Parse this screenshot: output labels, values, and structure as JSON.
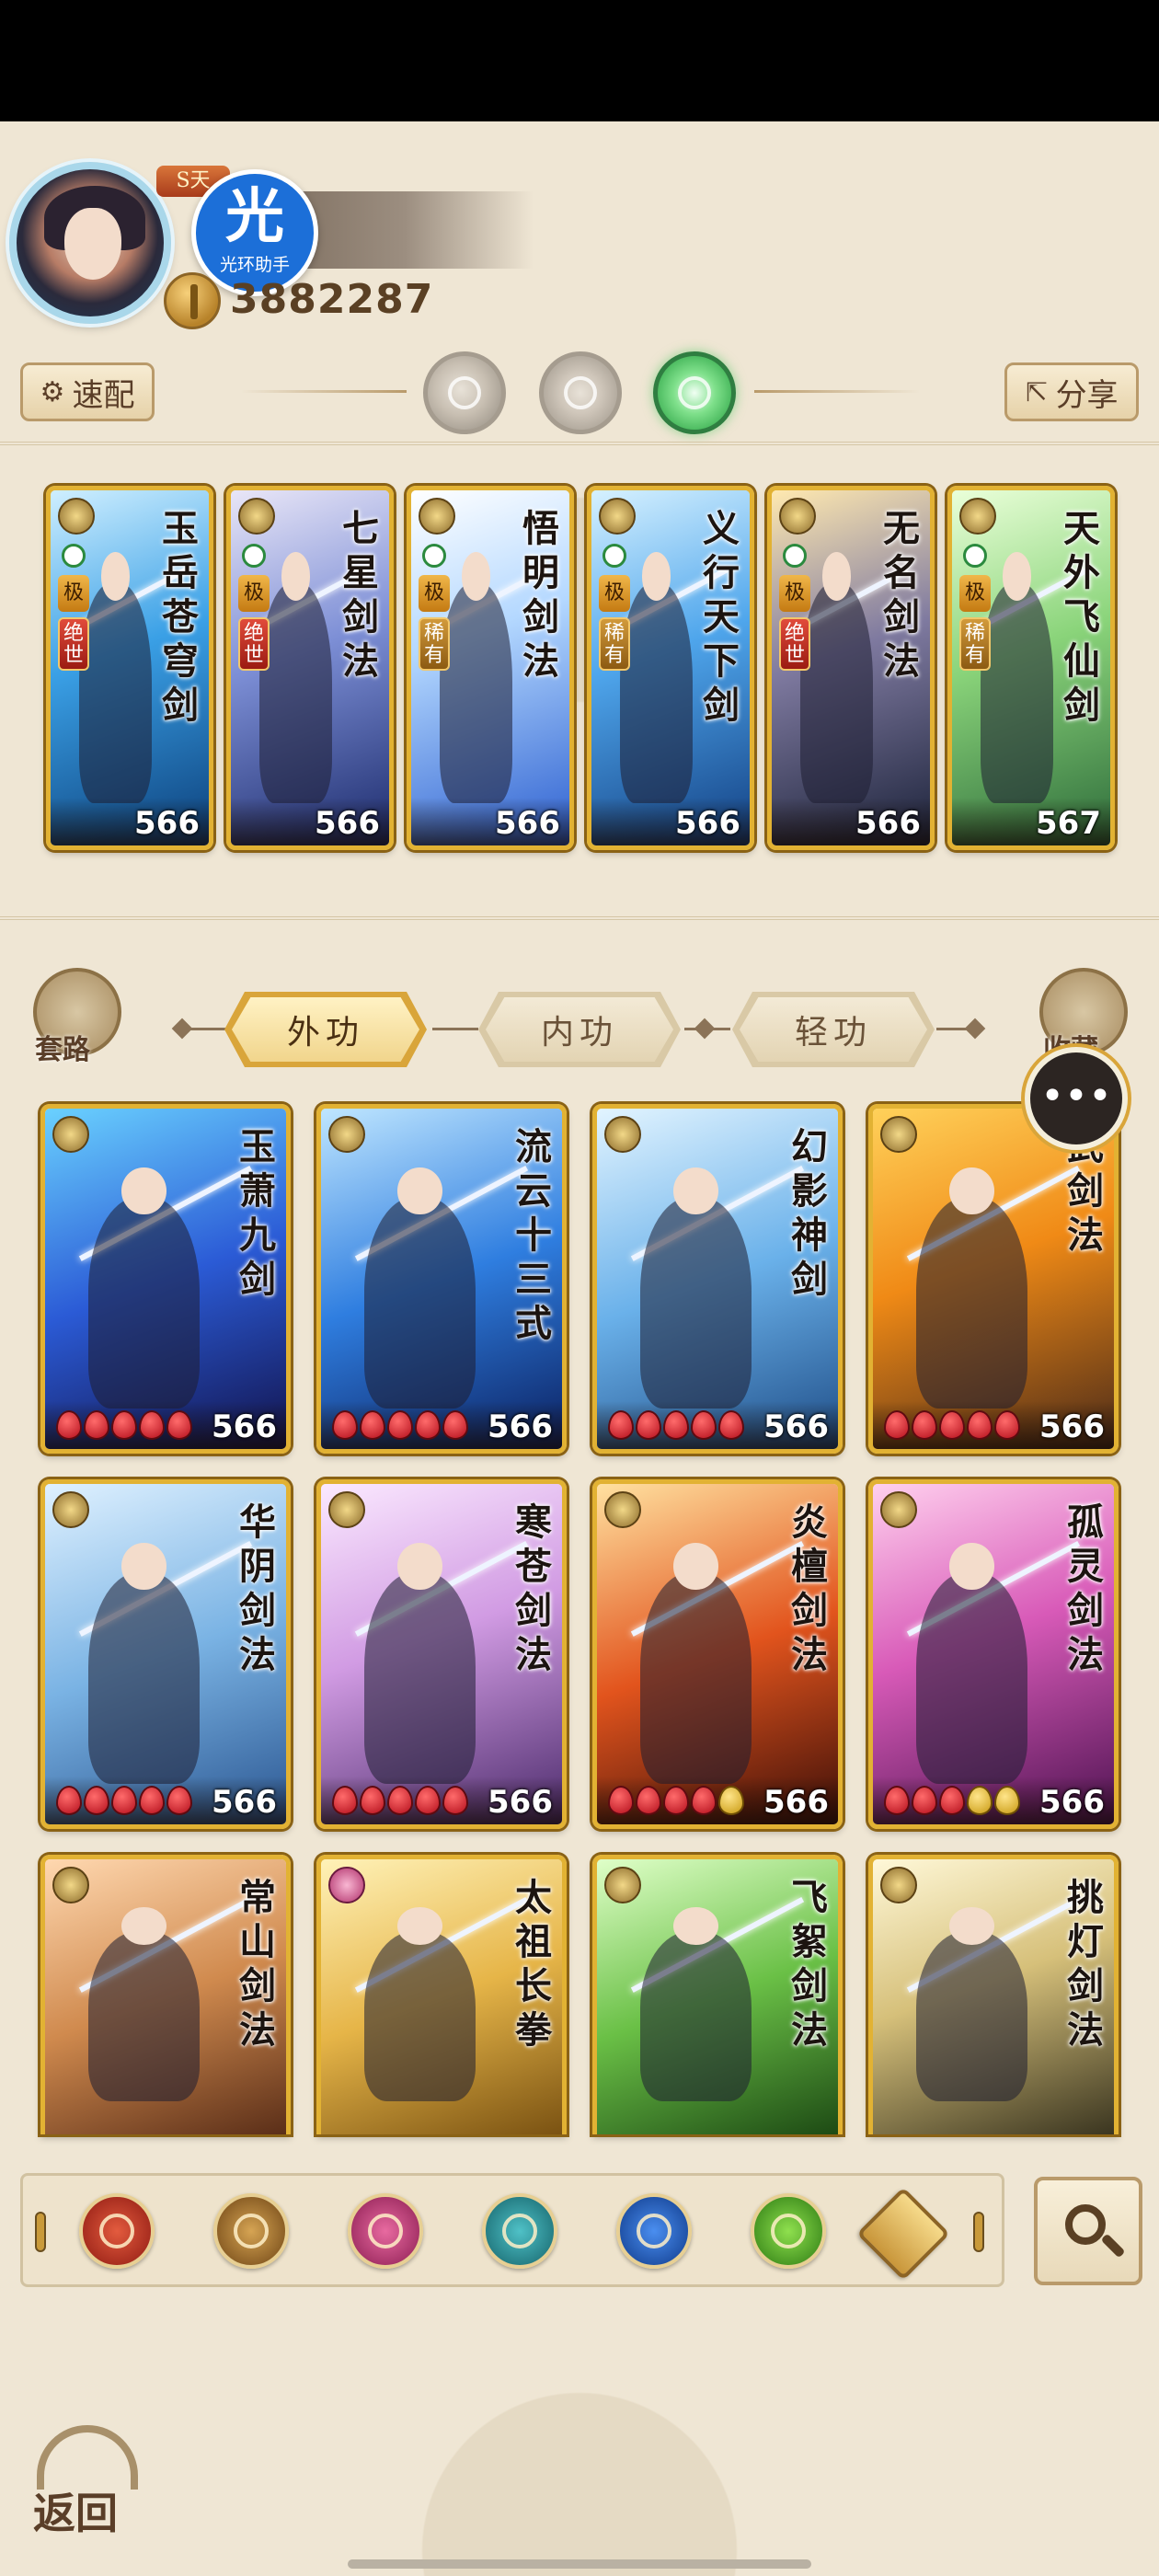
{
  "status_bar": {},
  "profile": {
    "rank_badge": "S天",
    "helper_badge": {
      "glyph": "光",
      "label": "光环助手"
    },
    "power_value": "3882287"
  },
  "toolbar": {
    "quick_label": "速配",
    "share_label": "分享",
    "mode_tabs": [
      "moon",
      "sun",
      "jade"
    ],
    "active_mode": "jade"
  },
  "equipped_skills": [
    {
      "title": "玉岳苍穹剑",
      "grade": "极",
      "rarity": "绝世",
      "level": "566"
    },
    {
      "title": "七星剑法",
      "grade": "极",
      "rarity": "绝世",
      "level": "566"
    },
    {
      "title": "悟明剑法",
      "grade": "极",
      "rarity": "稀有",
      "level": "566"
    },
    {
      "title": "义行天下剑",
      "grade": "极",
      "rarity": "稀有",
      "level": "566"
    },
    {
      "title": "无名剑法",
      "grade": "极",
      "rarity": "绝世",
      "level": "566"
    },
    {
      "title": "天外飞仙剑",
      "grade": "极",
      "rarity": "稀有",
      "level": "567"
    }
  ],
  "category": {
    "left_label": "套路",
    "right_label": "收藏",
    "tabs": [
      {
        "label": "外功",
        "active": true
      },
      {
        "label": "内功",
        "active": false
      },
      {
        "label": "轻功",
        "active": false
      }
    ]
  },
  "chat_icon": "chat-bubble-icon",
  "skill_grid": [
    {
      "title": "玉萧九剑",
      "level": "566",
      "red_gems": 5,
      "yellow_gems": 0
    },
    {
      "title": "流云十三式",
      "level": "566",
      "red_gems": 5,
      "yellow_gems": 0
    },
    {
      "title": "幻影神剑",
      "level": "566",
      "red_gems": 5,
      "yellow_gems": 0
    },
    {
      "title": "武剑法",
      "level": "566",
      "red_gems": 5,
      "yellow_gems": 0
    },
    {
      "title": "华阴剑法",
      "level": "566",
      "red_gems": 5,
      "yellow_gems": 0
    },
    {
      "title": "寒苍剑法",
      "level": "566",
      "red_gems": 5,
      "yellow_gems": 0
    },
    {
      "title": "炎檀剑法",
      "level": "566",
      "red_gems": 4,
      "yellow_gems": 1
    },
    {
      "title": "孤灵剑法",
      "level": "566",
      "red_gems": 3,
      "yellow_gems": 2
    },
    {
      "title": "常山剑法",
      "level": "",
      "red_gems": 0,
      "yellow_gems": 0
    },
    {
      "title": "太祖长拳",
      "level": "",
      "red_gems": 0,
      "yellow_gems": 0
    },
    {
      "title": "飞絮剑法",
      "level": "",
      "red_gems": 0,
      "yellow_gems": 0
    },
    {
      "title": "挑灯剑法",
      "level": "",
      "red_gems": 0,
      "yellow_gems": 0
    }
  ],
  "filters": [
    "blade-filter-icon",
    "sword-filter-icon",
    "fist-filter-icon",
    "fan-filter-icon",
    "taiji-filter-icon",
    "hidden-weapon-filter-icon",
    "other-filter-icon"
  ],
  "back_label": "返回",
  "colors": {
    "background": "#efe6d4",
    "card_border": "#e2b233",
    "accent_green": "#1f9a3a",
    "helper_blue": "#1c6fd8"
  }
}
